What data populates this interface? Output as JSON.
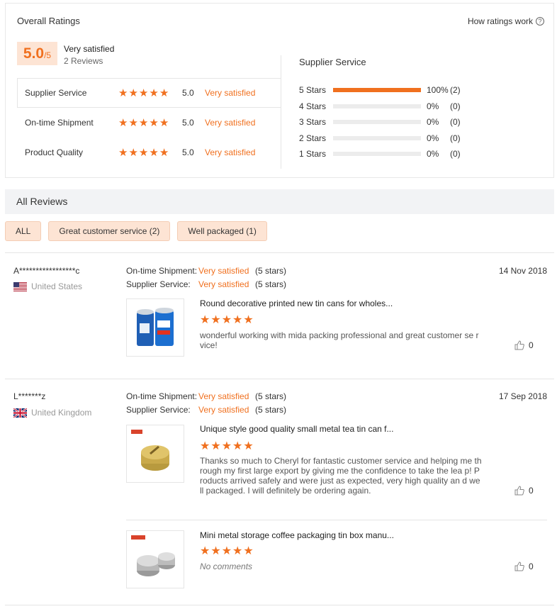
{
  "overall": {
    "title": "Overall Ratings",
    "how_link": "How ratings work",
    "help_glyph": "?",
    "score": "5.0",
    "score_suffix": "/5",
    "score_label": "Very satisfied",
    "reviews_count": "2 Reviews",
    "categories": [
      {
        "name": "Supplier Service",
        "score": "5.0",
        "text": "Very satisfied",
        "stars": 5
      },
      {
        "name": "On-time Shipment",
        "score": "5.0",
        "text": "Very satisfied",
        "stars": 5
      },
      {
        "name": "Product Quality",
        "score": "5.0",
        "text": "Very satisfied",
        "stars": 5
      }
    ],
    "supplier_service_title": "Supplier Service",
    "distribution": [
      {
        "label": "5  Stars",
        "fraction": 1.0,
        "pct": "100%",
        "count": "(2)"
      },
      {
        "label": "4  Stars",
        "fraction": 0.0,
        "pct": "0%",
        "count": "(0)"
      },
      {
        "label": "3  Stars",
        "fraction": 0.0,
        "pct": "0%",
        "count": "(0)"
      },
      {
        "label": "2  Stars",
        "fraction": 0.0,
        "pct": "0%",
        "count": "(0)"
      },
      {
        "label": "1  Stars",
        "fraction": 0.0,
        "pct": "0%",
        "count": "(0)"
      }
    ]
  },
  "all_reviews": {
    "title": "All Reviews",
    "filters": [
      "ALL",
      "Great customer service (2)",
      "Well packaged (1)"
    ]
  },
  "reviews": [
    {
      "name": "A*****************c",
      "country": "United States",
      "flag": "us-flag-icon",
      "date": "14 Nov 2018",
      "meta": [
        {
          "k": "On-time Shipment:",
          "v": "Very satisfied",
          "s": "(5 stars)"
        },
        {
          "k": "Supplier Service:",
          "v": "Very satisfied",
          "s": "(5 stars)"
        }
      ],
      "products": [
        {
          "title": "Round decorative printed new tin cans for wholes...",
          "text": "wonderful working with mida packing professional and great customer se rvice!",
          "likes": "0",
          "thumb": "blue-tin-cans-image"
        }
      ]
    },
    {
      "name": "L*******z",
      "country": "United Kingdom",
      "flag": "uk-flag-icon",
      "date": "17 Sep 2018",
      "meta": [
        {
          "k": "On-time Shipment:",
          "v": "Very satisfied",
          "s": "(5 stars)"
        },
        {
          "k": "Supplier Service:",
          "v": "Very satisfied",
          "s": "(5 stars)"
        }
      ],
      "products": [
        {
          "title": "Unique style good quality small metal tea tin can f...",
          "text": "Thanks so much to Cheryl for fantastic customer service and helping me through my first large export by giving me the confidence to take the lea p!  Products arrived safely and were just as expected, very high quality an d well packaged. I will definitely be ordering again.",
          "likes": "0",
          "thumb": "gold-tea-tin-image"
        },
        {
          "title": "Mini metal storage coffee packaging tin box manu...",
          "no_comment": "No comments",
          "likes": "0",
          "thumb": "silver-tin-box-image"
        }
      ]
    }
  ],
  "colors": {
    "accent": "#f0701f",
    "accent_bg": "#fde4d4",
    "star": "#f0701f"
  },
  "star_glyph": "★"
}
